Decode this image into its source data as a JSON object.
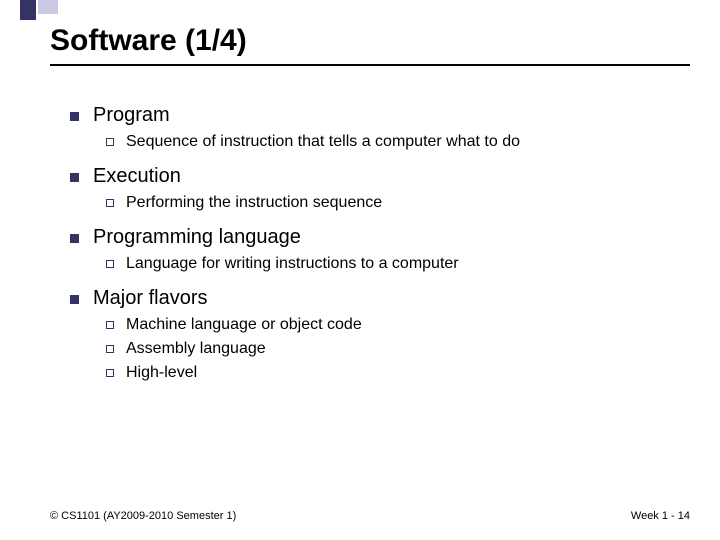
{
  "title": "Software (1/4)",
  "items": [
    {
      "label": "Program",
      "sub": [
        "Sequence of instruction that tells a computer what to do"
      ]
    },
    {
      "label": "Execution",
      "sub": [
        "Performing the instruction sequence"
      ]
    },
    {
      "label": "Programming language",
      "sub": [
        "Language for writing instructions to a computer"
      ]
    },
    {
      "label": "Major flavors",
      "sub": [
        "Machine language or object code",
        "Assembly language",
        "High-level"
      ]
    }
  ],
  "footer": {
    "left": "© CS1101 (AY2009-2010 Semester 1)",
    "right": "Week 1 - 14"
  }
}
